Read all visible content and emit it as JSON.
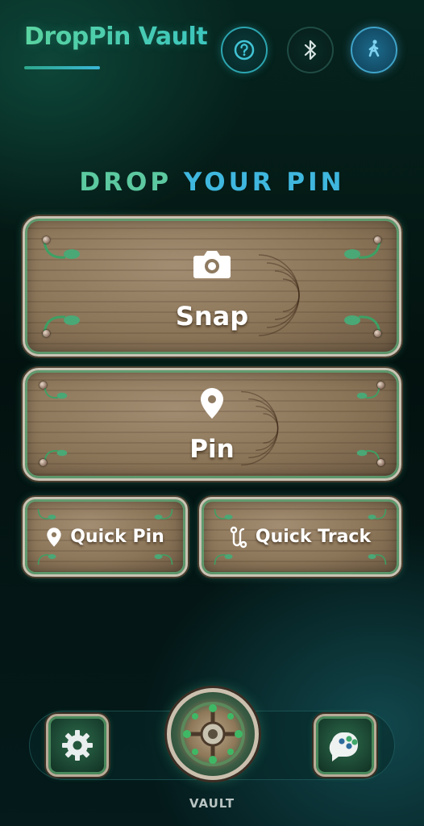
{
  "header": {
    "app_title": "DropPin Vault",
    "buttons": [
      {
        "name": "help",
        "icon": "question-circle-icon"
      },
      {
        "name": "bluetooth",
        "icon": "bluetooth-icon"
      },
      {
        "name": "walk-mode",
        "icon": "walking-person-icon"
      }
    ]
  },
  "main": {
    "heading_part1": "DROP",
    "heading_part2": "YOUR PIN",
    "snap": {
      "label": "Snap",
      "icon": "camera-icon"
    },
    "pin": {
      "label": "Pin",
      "icon": "map-pin-icon"
    },
    "quick_pin": {
      "label": "Quick Pin",
      "icon": "map-pin-icon"
    },
    "quick_track": {
      "label": "Quick Track",
      "icon": "route-icon"
    }
  },
  "dock": {
    "settings": {
      "icon": "gear-icon"
    },
    "vault": {
      "label": "VAULT",
      "icon": "vault-dial-icon"
    },
    "games": {
      "icon": "game-controller-icon"
    }
  },
  "colors": {
    "heading_green": "#5cc9a0",
    "heading_blue": "#3fb7de",
    "accent_teal": "#2ca5b0"
  }
}
